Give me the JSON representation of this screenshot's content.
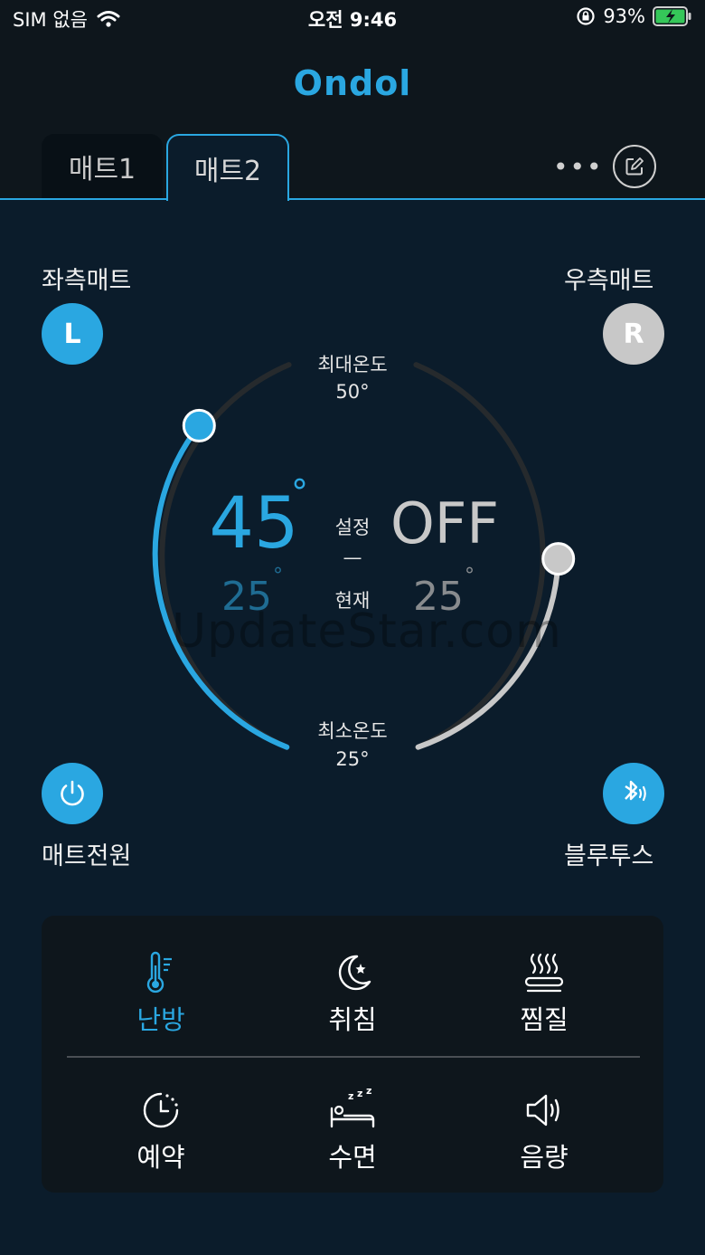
{
  "status_bar": {
    "carrier": "SIM 없음",
    "time": "오전 9:46",
    "battery": "93%"
  },
  "app": {
    "logo": "Ondol"
  },
  "tabs": [
    {
      "label": "매트1"
    },
    {
      "label": "매트2"
    }
  ],
  "left": {
    "title": "좌측매트",
    "badge": "L",
    "power_label": "매트전원"
  },
  "right": {
    "title": "우측매트",
    "badge": "R",
    "bluetooth_label": "블루투스"
  },
  "dial": {
    "max_label": "최대온도",
    "max_value": "50°",
    "min_label": "최소온도",
    "min_value": "25°",
    "left_set": "45",
    "left_current": "25",
    "right_set": "OFF",
    "right_current": "25",
    "deg": "°",
    "set_label": "설정",
    "dash": "—",
    "current_label": "현재"
  },
  "modes": [
    {
      "label": "난방",
      "icon": "thermometer-icon",
      "active": true
    },
    {
      "label": "취침",
      "icon": "moon-star-icon",
      "active": false
    },
    {
      "label": "찜질",
      "icon": "steam-heat-icon",
      "active": false
    },
    {
      "label": "예약",
      "icon": "timer-clock-icon",
      "active": false
    },
    {
      "label": "수면",
      "icon": "sleep-bed-icon",
      "active": false
    },
    {
      "label": "음량",
      "icon": "speaker-icon",
      "active": false
    }
  ],
  "watermark": "UpdateStar.com",
  "colors": {
    "accent": "#2aa7e1",
    "background": "#0b1c2b",
    "topbar": "#0e161c",
    "off_gray": "#c8c8c8"
  }
}
